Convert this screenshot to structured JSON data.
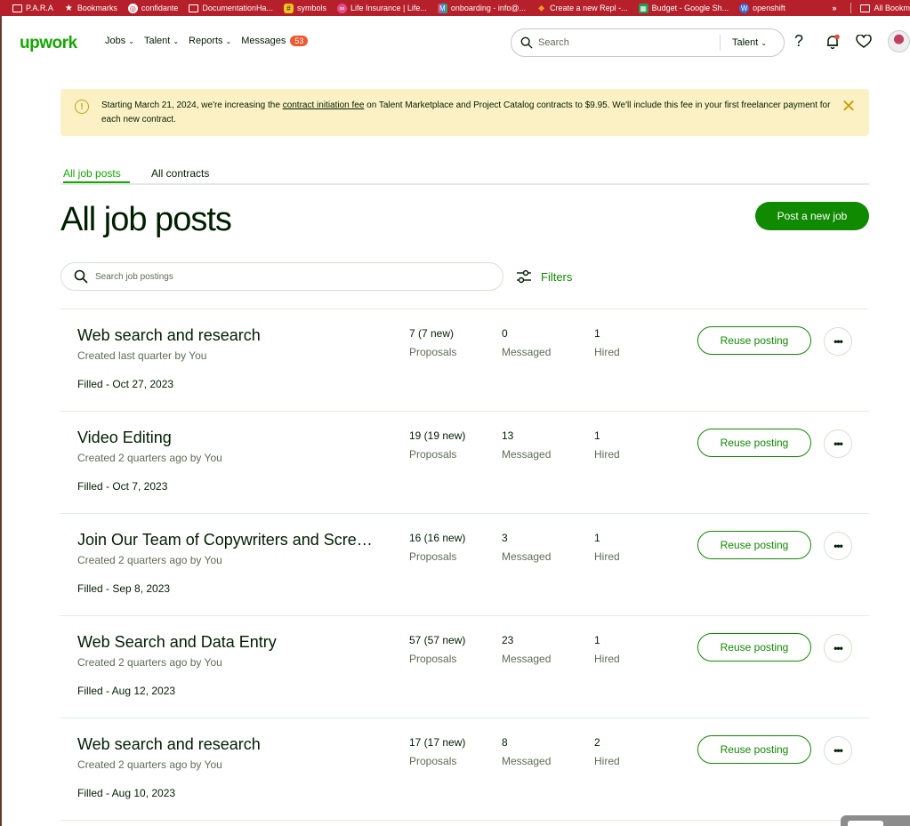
{
  "bookmarks": [
    {
      "label": "P.A.R.A",
      "icon": "folder-icon"
    },
    {
      "label": "Bookmarks",
      "icon": "star-icon"
    },
    {
      "label": "confidante",
      "icon": "globe-icon"
    },
    {
      "label": "DocumentationHa...",
      "icon": "folder-icon"
    },
    {
      "label": "symbols",
      "icon": "app-icon"
    },
    {
      "label": "Life Insurance | Life...",
      "icon": "site-icon"
    },
    {
      "label": "onboarding - info@...",
      "icon": "gmail-icon"
    },
    {
      "label": "Create a new Repl -...",
      "icon": "replit-icon"
    },
    {
      "label": "Budget - Google Sh...",
      "icon": "sheets-icon"
    },
    {
      "label": "openshift",
      "icon": "wordpress-icon"
    }
  ],
  "bookmarks_more": "»",
  "bookmarks_all": "All Bookm",
  "header": {
    "logo": "upwork",
    "nav": {
      "jobs": "Jobs",
      "talent": "Talent",
      "reports": "Reports",
      "messages": "Messages",
      "messages_count": "53"
    },
    "search_placeholder": "Search",
    "search_scope": "Talent",
    "help_glyph": "?"
  },
  "notice": {
    "text_before": "Starting March 21, 2024, we're increasing the ",
    "link": "contract initiation fee",
    "text_after": " on Talent Marketplace and Project Catalog contracts to $9.95. We'll include this fee in your first freelancer payment for each new contract."
  },
  "tabs": {
    "job_posts": "All job posts",
    "contracts": "All contracts"
  },
  "page": {
    "title": "All job posts",
    "post_job_label": "Post a new job",
    "search_placeholder": "Search job postings",
    "filters_label": "Filters"
  },
  "labels": {
    "proposals": "Proposals",
    "messaged": "Messaged",
    "hired": "Hired",
    "reuse": "Reuse posting",
    "more": "•••"
  },
  "jobs": [
    {
      "title": "Web search and research",
      "created": "Created last quarter by You",
      "status": "Filled - Oct 27, 2023",
      "proposals": "7 (7 new)",
      "messaged": "0",
      "hired": "1"
    },
    {
      "title": "Video Editing",
      "created": "Created 2 quarters ago by You",
      "status": "Filled - Oct 7, 2023",
      "proposals": "19 (19 new)",
      "messaged": "13",
      "hired": "1"
    },
    {
      "title": "Join Our Team of Copywriters and Scre…",
      "created": "Created 2 quarters ago by You",
      "status": "Filled - Sep 8, 2023",
      "proposals": "16 (16 new)",
      "messaged": "3",
      "hired": "1"
    },
    {
      "title": "Web Search and Data Entry",
      "created": "Created 2 quarters ago by You",
      "status": "Filled - Aug 12, 2023",
      "proposals": "57 (57 new)",
      "messaged": "23",
      "hired": "1"
    },
    {
      "title": "Web search and research",
      "created": "Created 2 quarters ago by You",
      "status": "Filled - Aug 10, 2023",
      "proposals": "17 (17 new)",
      "messaged": "8",
      "hired": "2"
    }
  ]
}
